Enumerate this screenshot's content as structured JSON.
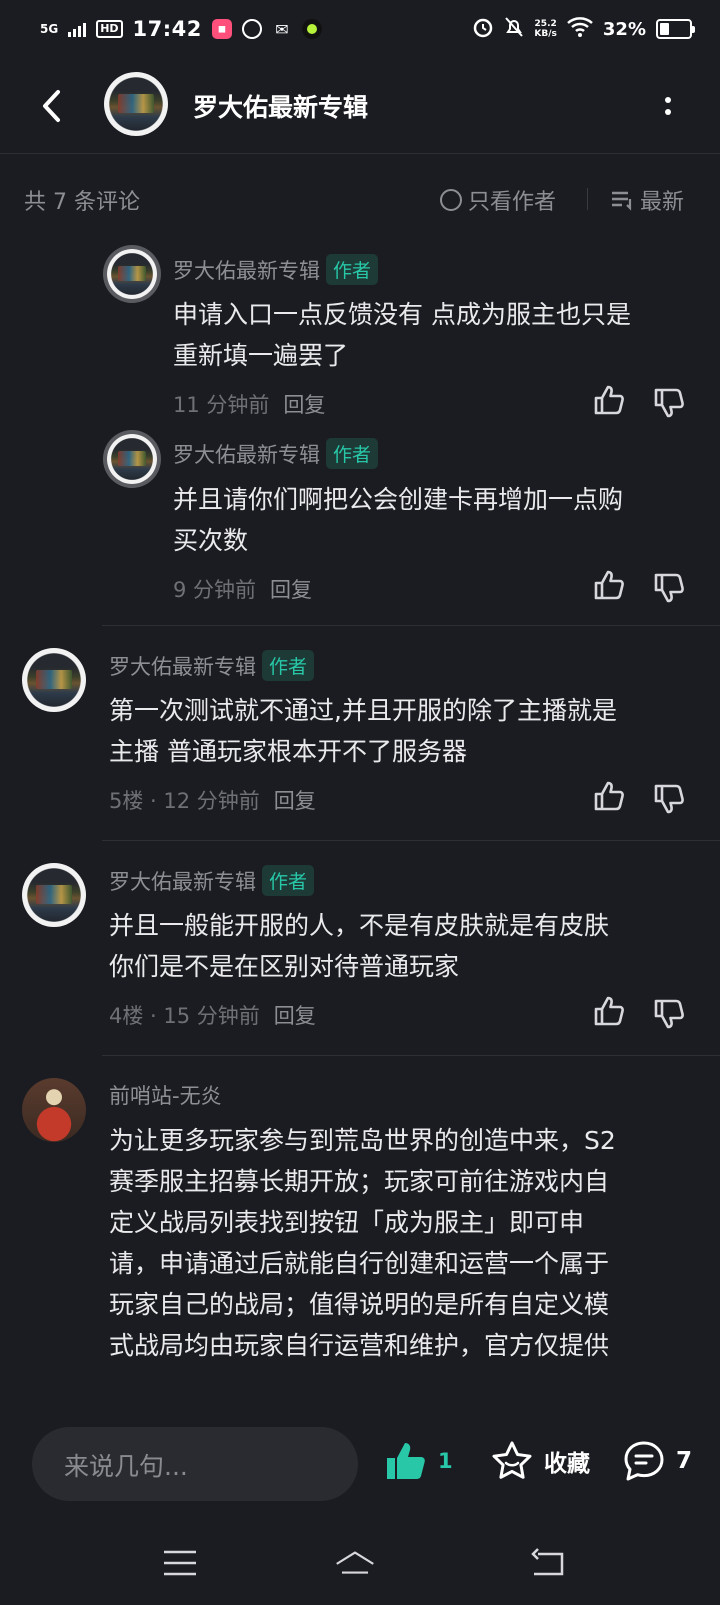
{
  "status_bar": {
    "network": "5G",
    "hd": "HD",
    "time": "17:42",
    "speed_value": "25.2",
    "speed_unit": "KB/s",
    "battery": "32%"
  },
  "header": {
    "title": "罗大佑最新专辑",
    "back_icon": "chevron-left-icon",
    "more_icon": "more-vertical-icon"
  },
  "comment_bar": {
    "count_text": "共 7 条评论",
    "only_author": "只看作者",
    "sort": "最新"
  },
  "replies": [
    {
      "author": "罗大佑最新专辑",
      "badge": "作者",
      "text_lines": [
        "申请入口一点反馈没有 点成为服主也只是",
        "重新填一遍罢了"
      ],
      "time": "11 分钟前",
      "reply": "回复"
    },
    {
      "author": "罗大佑最新专辑",
      "badge": "作者",
      "text_lines": [
        "并且请你们啊把公会创建卡再增加一点购",
        "买次数"
      ],
      "time": "9 分钟前",
      "reply": "回复"
    }
  ],
  "comments": [
    {
      "author": "罗大佑最新专辑",
      "badge": "作者",
      "text_lines": [
        "第一次测试就不通过,并且开服的除了主播就是",
        "主播 普通玩家根本开不了服务器"
      ],
      "floor": "5楼 · 12 分钟前",
      "reply": "回复"
    },
    {
      "author": "罗大佑最新专辑",
      "badge": "作者",
      "text_lines": [
        "并且一般能开服的人，不是有皮肤就是有皮肤",
        "你们是不是在区别对待普通玩家"
      ],
      "floor": "4楼 · 15 分钟前",
      "reply": "回复"
    },
    {
      "author": "前哨站-无炎",
      "text_lines": [
        "为让更多玩家参与到荒岛世界的创造中来，S2",
        "赛季服主招募长期开放；玩家可前往游戏内自",
        "定义战局列表找到按钮「成为服主」即可申",
        "请，申请通过后就能自行创建和运营一个属于",
        "玩家自己的战局；值得说明的是所有自定义模",
        "式战局均由玩家自行运营和维护，官方仅提供"
      ]
    }
  ],
  "bottom_bar": {
    "input_placeholder": "来说几句...",
    "like_count": "1",
    "favorite_label": "收藏",
    "comment_count": "7",
    "accent": "#27c7a8"
  },
  "nav_bar": {
    "menu_icon": "menu-icon",
    "home_icon": "home-icon",
    "back_icon": "back-icon"
  }
}
